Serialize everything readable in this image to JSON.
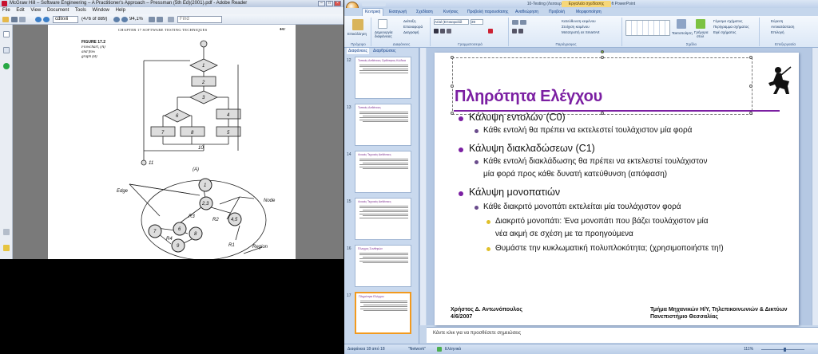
{
  "reader": {
    "title": "McGraw Hill – Software Engineering – A Practitioner's Approach – Pressman (5th Ed)(2001).pdf - Adobe Reader",
    "menu": [
      "File",
      "Edit",
      "View",
      "Document",
      "Tools",
      "Window",
      "Help"
    ],
    "page_input": "cdlxvii",
    "page_of": "(476 of 889)",
    "zoom": "94,1%",
    "find_placeholder": "Find",
    "pdf": {
      "header_left": "CHAPTER 17   SOFTWARE TESTING TECHNIQUES",
      "header_right": "447",
      "figure_label": "FIGURE 17.2",
      "figure_caption_1": "Flowchart, (A)",
      "figure_caption_2": "and flow",
      "figure_caption_3": "graph (B)",
      "label_a": "(A)",
      "label_edge": "Edge",
      "label_node": "Node",
      "label_region": "Region",
      "label_r1": "R1",
      "label_r2": "R2",
      "label_r3": "R3",
      "label_r4": "R4",
      "flow_nodes": [
        "1",
        "2",
        "3",
        "6",
        "4",
        "7",
        "8",
        "5",
        "9",
        "10",
        "11"
      ],
      "graph_nodes": [
        "1",
        "2,3",
        "6",
        "4,5",
        "7",
        "8",
        "9"
      ]
    }
  },
  "ppt": {
    "title": "10-Testing (Λειτουργία συμβατότητας) - Microsoft PowerPoint",
    "tools_tab": "Εργαλεία σχεδίασης",
    "tabs": [
      "Κεντρική",
      "Εισαγωγή",
      "Σχεδίαση",
      "Κινήσεις",
      "Προβολή παρουσίασης",
      "Αναθεώρηση",
      "Προβολή",
      "Μορφοποίηση"
    ],
    "ribbon": {
      "paste": "Επικόλληση",
      "new_slide_1": "Δημιουργία",
      "new_slide_2": "διαφάνειας",
      "layout": "Διάταξη",
      "reset": "Επαναφορά",
      "delete": "Διαγραφή",
      "font_name": "Arial (Επικεφαλίδ",
      "font_size": "39",
      "text_direction": "Κατεύθυνση κειμένου",
      "align_text": "Στοίχιση κειμένου",
      "smartart": "Μετατροπή σε SmartArt",
      "arrange": "Τακτοποίηση",
      "quick_styles_1": "Γρήγορα",
      "quick_styles_2": "στυλ",
      "shape_fill": "Γέμισμα σχήματος",
      "shape_outline": "Περίγραμμα σχήματος",
      "shape_effects": "Εφέ σχήματος",
      "find": "Εύρεση",
      "replace": "Αντικατάσταση",
      "select": "Επιλογή",
      "group_clipboard": "Πρόχειρο",
      "group_slides": "Διαφάνειες",
      "group_font": "Γραμματοσειρά",
      "group_paragraph": "Παράγραφος",
      "group_drawing": "Σχέδιο",
      "group_editing": "Επεξεργασία"
    },
    "panel_tabs": [
      "Διαφάνειες",
      "Διαρθρώσεις"
    ],
    "thumbnails": [
      {
        "num": "12",
        "title": "Τυπικές Ασθένειες Ορθότητας Κώδικα",
        "lines": 5
      },
      {
        "num": "13",
        "title": "Τυπικές Ασθένειες",
        "lines": 6
      },
      {
        "num": "14",
        "title": "Λευκές Τεχνικές Ασθένειες",
        "lines": 6
      },
      {
        "num": "15",
        "title": "Λευκές Τεχνικές Ασθένειες",
        "lines": 7
      },
      {
        "num": "16",
        "title": "Έλεγχος Συνθηκών",
        "lines": 6
      },
      {
        "num": "17",
        "title": "Πληρότητα Ελέγχου",
        "lines": 6
      }
    ],
    "slide": {
      "title": "Πληρότητα Ελέγχου",
      "bullets": [
        {
          "level": 1,
          "text": "Κάλυψη εντολών (C0)"
        },
        {
          "level": 2,
          "text": "Κάθε εντολή θα πρέπει να εκτελεστεί τουλάχιστον μία φορά"
        },
        {
          "level": 1,
          "text": "Κάλυψη διακλαδώσεων (C1)"
        },
        {
          "level": 2,
          "text": "Κάθε εντολή διακλάδωσης θα πρέπει να εκτελεστεί τουλάχιστον"
        },
        {
          "level": 0,
          "text": "μία φορά προς κάθε δυνατή κατεύθυνση (απόφαση)"
        },
        {
          "level": 1,
          "text": "Κάλυψη μονοπατιών"
        },
        {
          "level": 2,
          "text": "Κάθε διακριτό μονοπάτι εκτελείται μία τουλάχιστον φορά"
        },
        {
          "level": 3,
          "text": "Διακριτό μονοπάτι: Ένα μονοπάτι που βάζει τουλάχιστον μία"
        },
        {
          "level": 4,
          "text": "νέα ακμή σε σχέση με τα προηγούμενα"
        },
        {
          "level": 3,
          "text": "Θυμάστε την κυκλωματική πολυπλοκότητα; (χρησιμοποιήστε τη!)"
        }
      ],
      "footer_left_1": "Χρήστος Δ. Αντωνόπουλος",
      "footer_left_2": "4/6/2007",
      "footer_right_1": "Τμήμα Μηχανικών Η/Υ, Τηλεπικοινωνιών & Δικτύων",
      "footer_right_2": "Πανεπιστήμιο Θεσσαλίας"
    },
    "notes_placeholder": "Κάντε κλικ για να προσθέσετε σημειώσεις",
    "status": {
      "slide_of": "Διαφάνεια 18 από 18",
      "theme": "\"Network\"",
      "language": "Ελληνικά",
      "zoom": "111%"
    }
  }
}
